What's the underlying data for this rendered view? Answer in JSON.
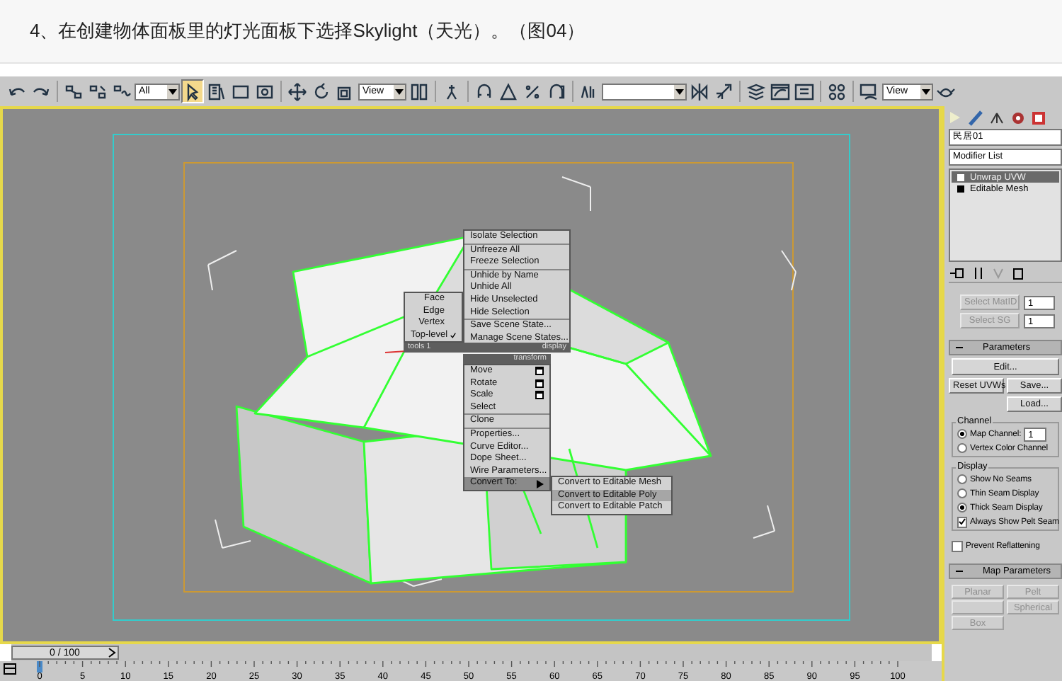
{
  "caption": "4、在创建物体面板里的灯光面板下选择Skylight（天光）。（图04）",
  "toolbar": {
    "selection_filter": "All",
    "select_tool_pressed": true,
    "reference_coord": "View",
    "render_view": "View"
  },
  "quad_menu": {
    "tools_header": "tools 1",
    "display_header": "display",
    "transform_header": "transform",
    "tools_items": [
      {
        "label": "Face",
        "checked": false
      },
      {
        "label": "Edge",
        "checked": false
      },
      {
        "label": "Vertex",
        "checked": false
      },
      {
        "label": "Top-level",
        "checked": true
      }
    ],
    "display_groups": [
      [
        "Isolate Selection"
      ],
      [
        "Unfreeze All",
        "Freeze Selection"
      ],
      [
        "Unhide by Name",
        "Unhide All",
        "Hide Unselected",
        "Hide Selection"
      ],
      [
        "Save Scene State...",
        "Manage Scene States..."
      ]
    ],
    "transform_groups": [
      [
        {
          "label": "Move",
          "kind": "settings",
          "selected": false
        },
        {
          "label": "Rotate",
          "kind": "settings",
          "selected": false
        },
        {
          "label": "Scale",
          "kind": "settings",
          "selected": false
        },
        {
          "label": "Select",
          "kind": "plain",
          "selected": false
        }
      ],
      [
        {
          "label": "Clone",
          "kind": "plain",
          "selected": false
        }
      ],
      [
        {
          "label": "Properties...",
          "kind": "plain",
          "selected": false
        },
        {
          "label": "Curve Editor...",
          "kind": "plain",
          "selected": false
        },
        {
          "label": "Dope Sheet...",
          "kind": "plain",
          "selected": false
        },
        {
          "label": "Wire Parameters...",
          "kind": "plain",
          "selected": false
        },
        {
          "label": "Convert To:",
          "kind": "submenu",
          "selected": true
        }
      ]
    ],
    "submenu": [
      {
        "label": "Convert to Editable Mesh",
        "selected": false
      },
      {
        "label": "Convert to Editable Poly",
        "selected": true
      },
      {
        "label": "Convert to Editable Patch",
        "selected": false
      }
    ]
  },
  "command_panel": {
    "object_name": "民居01",
    "modifier_list": "Modifier List",
    "stack": [
      {
        "label": "Unwrap UVW",
        "selected": true
      },
      {
        "label": "Editable Mesh",
        "selected": false
      }
    ],
    "select_buttons": [
      {
        "label": "Select MatID",
        "disabled": true,
        "value": "1"
      },
      {
        "label": "Select SG",
        "disabled": true,
        "value": "1"
      }
    ],
    "parameters_rollout": "Parameters",
    "edit_button": "Edit...",
    "reset_button": "Reset UVWs",
    "save_button": "Save...",
    "load_button": "Load...",
    "channel_group": {
      "title": "Channel",
      "options": [
        {
          "label": "Map Channel:",
          "selected": true,
          "value": "1"
        },
        {
          "label": "Vertex Color Channel",
          "selected": false
        }
      ]
    },
    "display_group": {
      "title": "Display",
      "options": [
        {
          "label": "Show No Seams",
          "selected": false
        },
        {
          "label": "Thin Seam Display",
          "selected": false
        },
        {
          "label": "Thick Seam Display",
          "selected": true
        }
      ],
      "pelt_seam": {
        "label": "Always Show Pelt Seam",
        "checked": true
      }
    },
    "prevent_reflattening": {
      "label": "Prevent Reflattening",
      "checked": false
    },
    "map_rollout": "Map Parameters",
    "map_buttons": [
      {
        "label": "Planar",
        "disabled": true
      },
      {
        "label": "Pelt",
        "disabled": true
      },
      {
        "disabled": true
      },
      {
        "label": "Spherical",
        "disabled": true
      },
      {
        "label": "Box",
        "disabled": true
      }
    ]
  },
  "timeline": {
    "position": "0 / 100",
    "level": 0,
    "ticks": [
      "0",
      "5",
      "10",
      "15",
      "20",
      "25",
      "30",
      "35",
      "40",
      "45",
      "50",
      "55",
      "60",
      "65",
      "70",
      "75",
      "80",
      "85",
      "90",
      "95",
      "100"
    ]
  }
}
